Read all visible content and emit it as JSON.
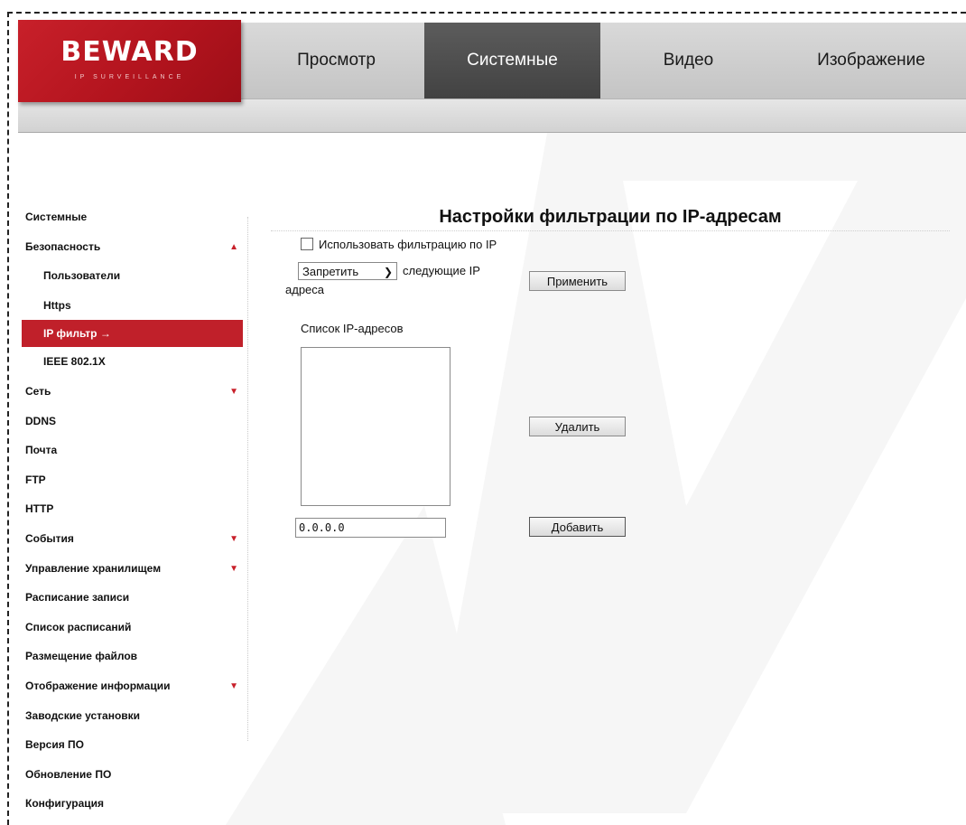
{
  "logo": {
    "brand": "BEWARD",
    "tagline": "IP SURVEILLANCE"
  },
  "nav": {
    "tabs": [
      "Просмотр",
      "Системные",
      "Видео",
      "Изображение"
    ],
    "active": "Системные"
  },
  "sidebar": {
    "items": [
      {
        "label": "Системные"
      },
      {
        "label": "Безопасность",
        "expanded": true
      },
      {
        "label": "Пользователи"
      },
      {
        "label": "Https"
      },
      {
        "label": "IP фильтр",
        "active": true,
        "arrow": "→"
      },
      {
        "label": "IEEE 802.1X"
      },
      {
        "label": "Сеть",
        "expanded": false
      },
      {
        "label": "DDNS"
      },
      {
        "label": "Почта"
      },
      {
        "label": "FTP"
      },
      {
        "label": "HTTP"
      },
      {
        "label": "События",
        "expanded": false
      },
      {
        "label": "Управление хранилищем",
        "expanded": false
      },
      {
        "label": "Расписание записи"
      },
      {
        "label": "Список расписаний"
      },
      {
        "label": "Размещение файлов"
      },
      {
        "label": "Отображение информации",
        "expanded": false
      },
      {
        "label": "Заводские установки"
      },
      {
        "label": "Версия ПО"
      },
      {
        "label": "Обновление ПО"
      },
      {
        "label": "Конфигурация"
      }
    ]
  },
  "main": {
    "title": "Настройки фильтрации по IP-адресам",
    "use_filter": {
      "label": "Использовать фильтрацию по IP",
      "checked": false
    },
    "mode": {
      "value": "Запретить"
    },
    "follow_text": "следующие IP",
    "addr_text": "адреса",
    "apply_button": "Применить",
    "list_label": "Список IP-адресов",
    "list_items": [],
    "delete_button": "Удалить",
    "ip_value": "0.0.0.0",
    "add_button": "Добавить"
  },
  "colors": {
    "accent": "#c8202a",
    "active_tab": "#4a4a4a"
  }
}
